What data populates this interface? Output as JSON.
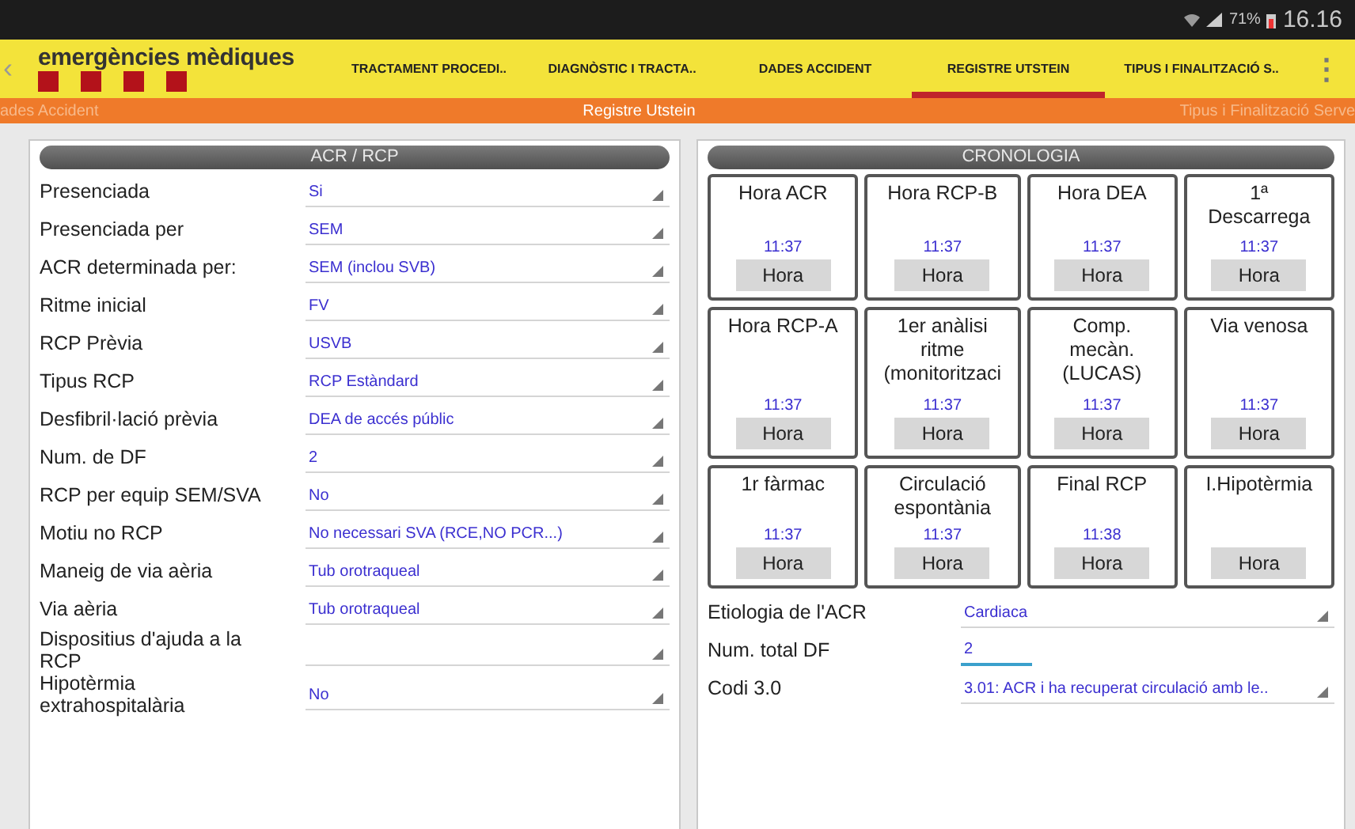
{
  "status_bar": {
    "battery": "71%",
    "time": "16.16"
  },
  "app_bar": {
    "logo": "emergències mèdiques",
    "back": "‹",
    "menu": "⋮",
    "tabs": [
      {
        "label": "TRACTAMENT PROCEDI..",
        "selected": false
      },
      {
        "label": "DIAGNÒSTIC I TRACTA..",
        "selected": false
      },
      {
        "label": "DADES ACCIDENT",
        "selected": false
      },
      {
        "label": "REGISTRE UTSTEIN",
        "selected": true
      },
      {
        "label": "TIPUS I FINALITZACIÓ S..",
        "selected": false
      }
    ]
  },
  "page_strip": {
    "previous": "ades Accident",
    "current": "Registre Utstein",
    "next": "Tipus i Finalització Serve"
  },
  "left_panel": {
    "title": "ACR / RCP",
    "fields": [
      {
        "label": "Presenciada",
        "value": "Si",
        "kind": "select"
      },
      {
        "label": "Presenciada per",
        "value": "SEM",
        "kind": "select"
      },
      {
        "label": "ACR determinada per:",
        "value": "SEM (inclou SVB)",
        "kind": "select"
      },
      {
        "label": "Ritme inicial",
        "value": "FV",
        "kind": "select"
      },
      {
        "label": "RCP Prèvia",
        "value": "USVB",
        "kind": "select"
      },
      {
        "label": "Tipus RCP",
        "value": "RCP Estàndard",
        "kind": "select"
      },
      {
        "label": "Desfibril·lació prèvia",
        "value": "DEA de accés públic",
        "kind": "select"
      },
      {
        "label": "Num. de DF",
        "value": "2",
        "kind": "select"
      },
      {
        "label": "RCP per equip SEM/SVA",
        "value": "No",
        "kind": "select"
      },
      {
        "label": "Motiu no RCP",
        "value": "No necessari SVA (RCE,NO PCR...)",
        "kind": "select"
      },
      {
        "label": "Maneig de via aèria",
        "value": "Tub orotraqueal",
        "kind": "select"
      },
      {
        "label": "Via aèria",
        "value": "Tub orotraqueal",
        "kind": "select"
      },
      {
        "label": "Dispositius d'ajuda a la RCP",
        "kind": "select"
      },
      {
        "label": "Hipotèrmia extrahospitalària",
        "value": "No",
        "kind": "select"
      }
    ]
  },
  "right_panel": {
    "title": "CRONOLOGIA",
    "timers": [
      {
        "label": "Hora ACR",
        "time": "11:37",
        "button": "Hora"
      },
      {
        "label": "Hora RCP-B",
        "time": "11:37",
        "button": "Hora"
      },
      {
        "label": "Hora DEA",
        "time": "11:37",
        "button": "Hora"
      },
      {
        "label": "1ª Descarrega",
        "time": "11:37",
        "button": "Hora"
      },
      {
        "label": "Hora RCP-A",
        "time": "11:37",
        "button": "Hora"
      },
      {
        "label": "1er anàlisi ritme (monitoritzaci",
        "time": "11:37",
        "button": "Hora"
      },
      {
        "label": "Comp. mecàn. (LUCAS)",
        "time": "11:37",
        "button": "Hora"
      },
      {
        "label": "Via venosa",
        "time": "11:37",
        "button": "Hora"
      },
      {
        "label": "1r fàrmac",
        "time": "11:37",
        "button": "Hora"
      },
      {
        "label": "Circulació espontània",
        "time": "11:37",
        "button": "Hora"
      },
      {
        "label": "Final RCP",
        "time": "11:38",
        "button": "Hora"
      },
      {
        "label": "I.Hipotèrmia",
        "button": "Hora"
      }
    ],
    "fields": [
      {
        "label": "Etiologia de l'ACR",
        "value": "Cardiaca",
        "kind": "select"
      },
      {
        "label": "Num. total DF",
        "value": "2",
        "kind": "input"
      },
      {
        "label": "Codi 3.0",
        "value": "3.01: ACR i ha recuperat circulació amb le..",
        "kind": "select"
      }
    ]
  }
}
